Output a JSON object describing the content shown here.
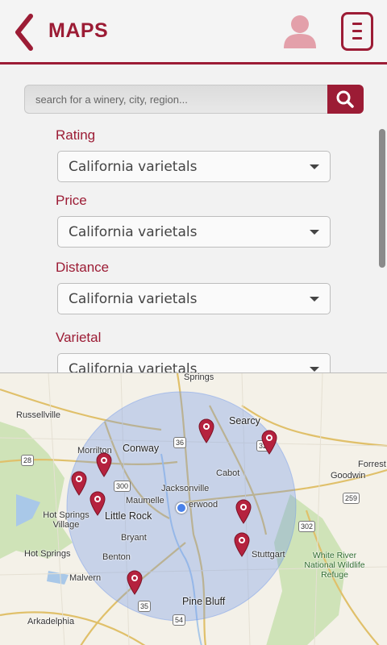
{
  "header": {
    "title": "MAPS",
    "brand_color": "#9c1c35",
    "back_icon": "chevron-left-icon",
    "profile_icon": "user-icon",
    "menu_icon": "hamburger-menu-icon"
  },
  "search": {
    "placeholder": "search for a winery, city, region...",
    "value": "",
    "button_icon": "search-icon"
  },
  "filters": [
    {
      "label": "Rating",
      "selected": "California varietals"
    },
    {
      "label": "Price",
      "selected": "California varietals"
    },
    {
      "label": "Distance",
      "selected": "California varietals"
    },
    {
      "label": "Varietal",
      "selected": "California varietals"
    }
  ],
  "map": {
    "places": [
      "Springs",
      "Russellville",
      "Searcy",
      "Conway",
      "Morrilton",
      "Cabot",
      "Forrest",
      "Goodwin",
      "Jacksonville",
      "Maumelle",
      "Little Rock",
      "erwood",
      "Hot Springs Village",
      "Hot Springs",
      "Bryant",
      "Benton",
      "Stuttgart",
      "White River National Wildlife Refuge",
      "Malvern",
      "Pine Bluff",
      "Arkadelphia"
    ],
    "highways": [
      "28",
      "36",
      "300",
      "32",
      "259",
      "302",
      "35",
      "54"
    ],
    "pin_count": 8
  }
}
